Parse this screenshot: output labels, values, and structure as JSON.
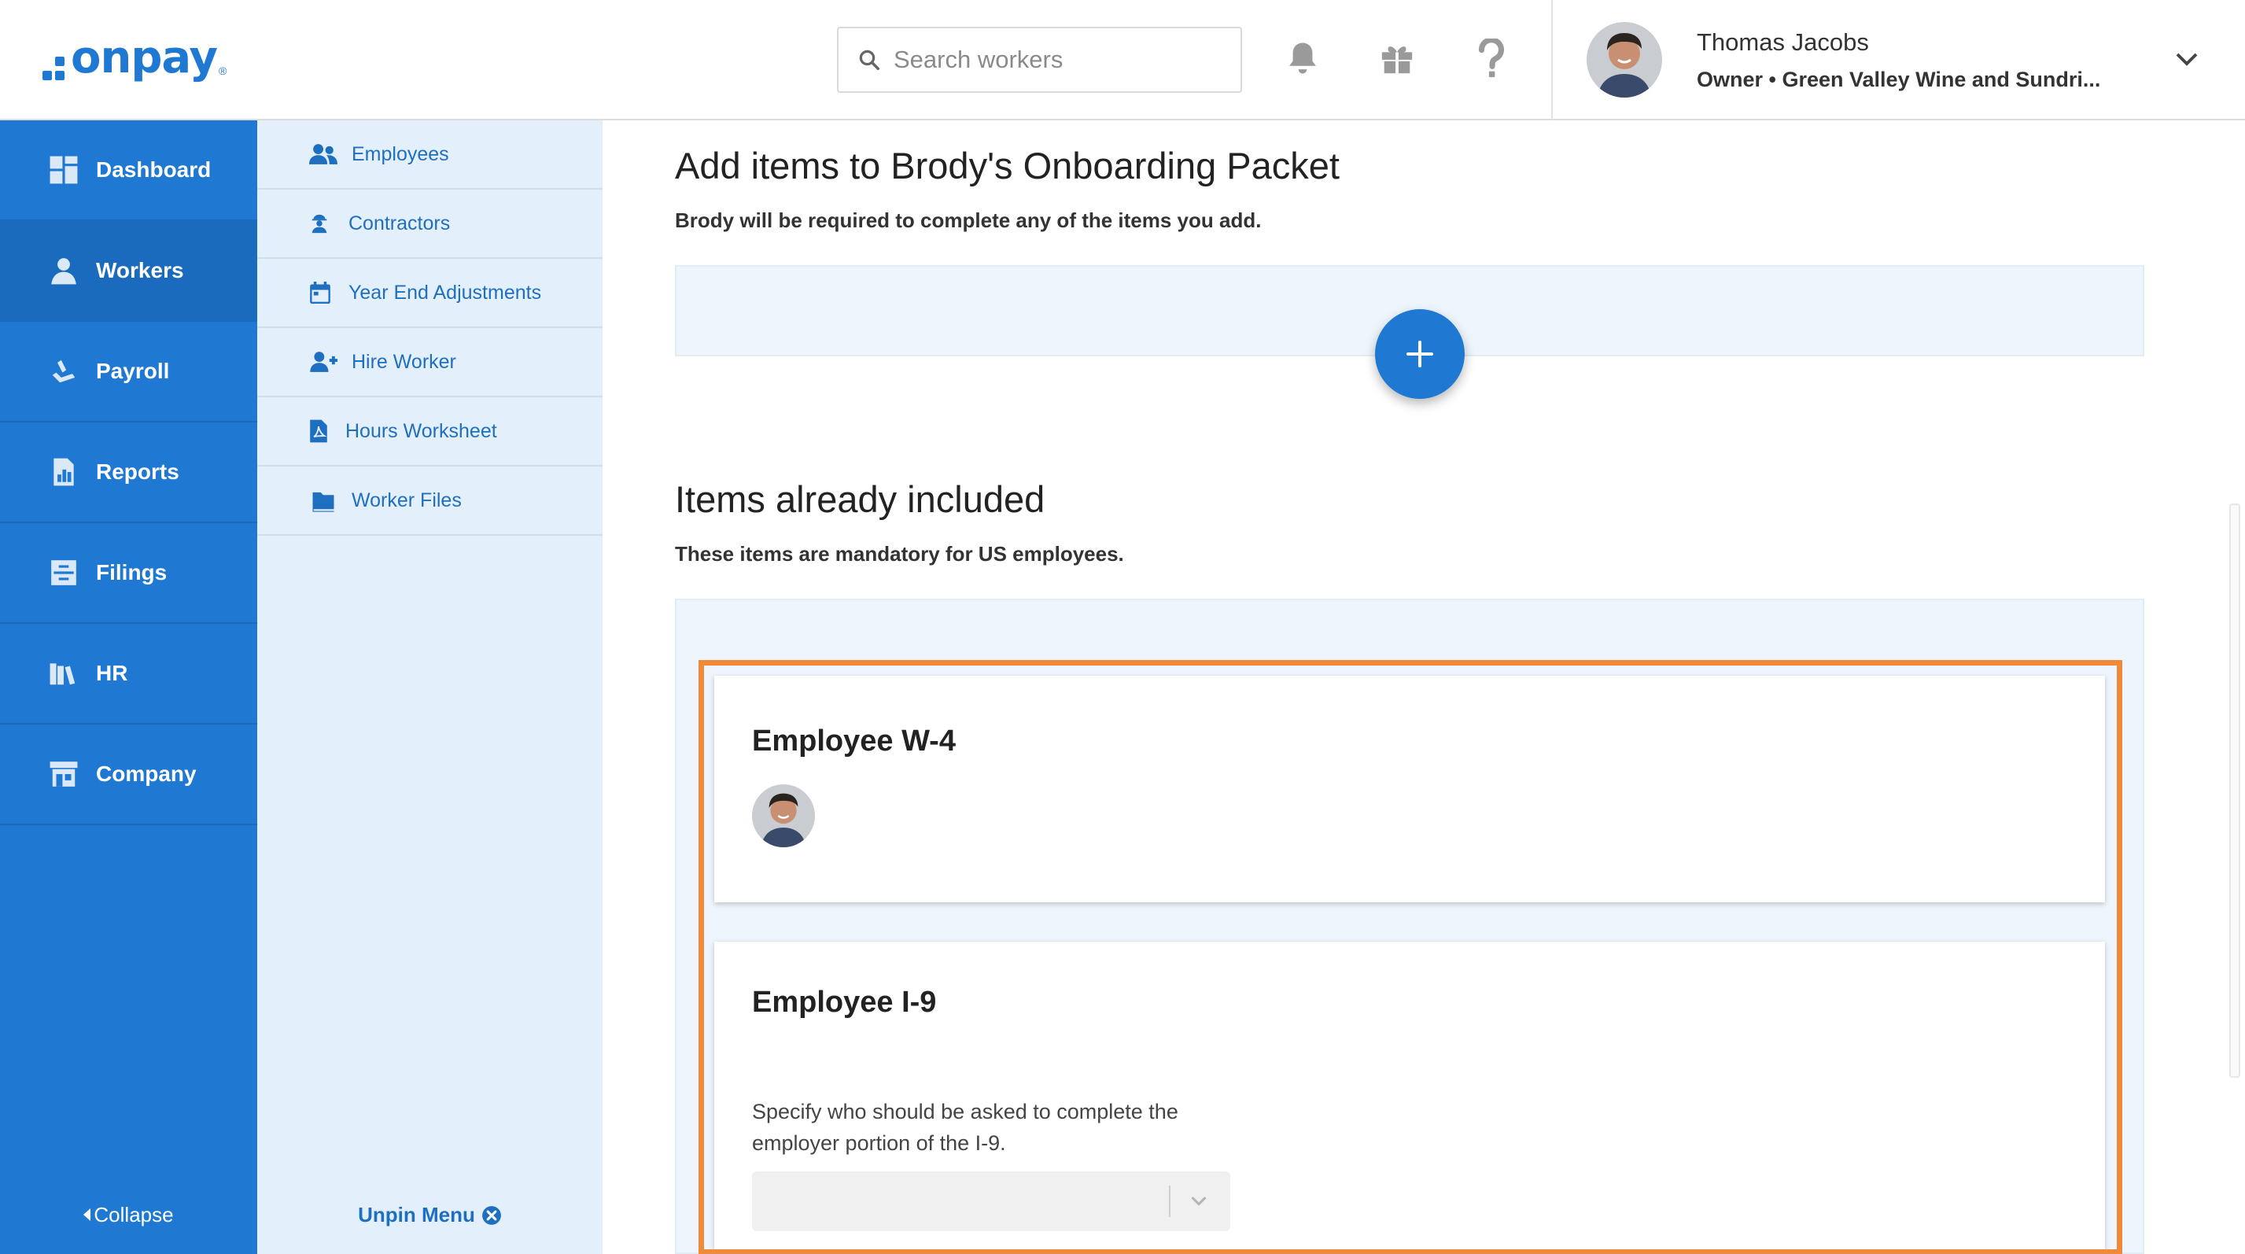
{
  "brand": {
    "name": "onpay",
    "registered": "®",
    "color": "#1f78d1"
  },
  "header": {
    "search_placeholder": "Search workers",
    "user": {
      "name": "Thomas Jacobs",
      "role": "Owner • Green Valley Wine and Sundri..."
    },
    "icons": [
      "bell-icon",
      "gift-icon",
      "question-icon",
      "chevron-down-icon"
    ]
  },
  "sidebar": {
    "items": [
      {
        "label": "Dashboard",
        "icon": "dashboard-icon"
      },
      {
        "label": "Workers",
        "icon": "workers-icon",
        "active": true
      },
      {
        "label": "Payroll",
        "icon": "payroll-icon"
      },
      {
        "label": "Reports",
        "icon": "reports-icon"
      },
      {
        "label": "Filings",
        "icon": "filings-icon"
      },
      {
        "label": "HR",
        "icon": "hr-icon"
      },
      {
        "label": "Company",
        "icon": "company-icon"
      }
    ],
    "collapse_label": "Collapse"
  },
  "subnav": {
    "items": [
      {
        "label": "Employees",
        "icon": "employees-icon"
      },
      {
        "label": "Contractors",
        "icon": "contractor-icon"
      },
      {
        "label": "Year End Adjustments",
        "icon": "calendar-icon"
      },
      {
        "label": "Hire Worker",
        "icon": "add-user-icon"
      },
      {
        "label": "Hours Worksheet",
        "icon": "pdf-icon"
      },
      {
        "label": "Worker Files",
        "icon": "folder-icon"
      }
    ],
    "unpin_label": "Unpin Menu"
  },
  "main": {
    "add_title": "Add items to Brody's Onboarding Packet",
    "add_description": "Brody will be required to complete any of the items you add.",
    "included_title": "Items already included",
    "included_description": "These items are mandatory for US employees.",
    "cards": [
      {
        "title": "Employee W-4"
      },
      {
        "title": "Employee I-9",
        "text": "Specify who should be asked to complete the employer portion of the I-9.",
        "select_value": ""
      }
    ],
    "highlight_color": "#ef8a3a"
  }
}
